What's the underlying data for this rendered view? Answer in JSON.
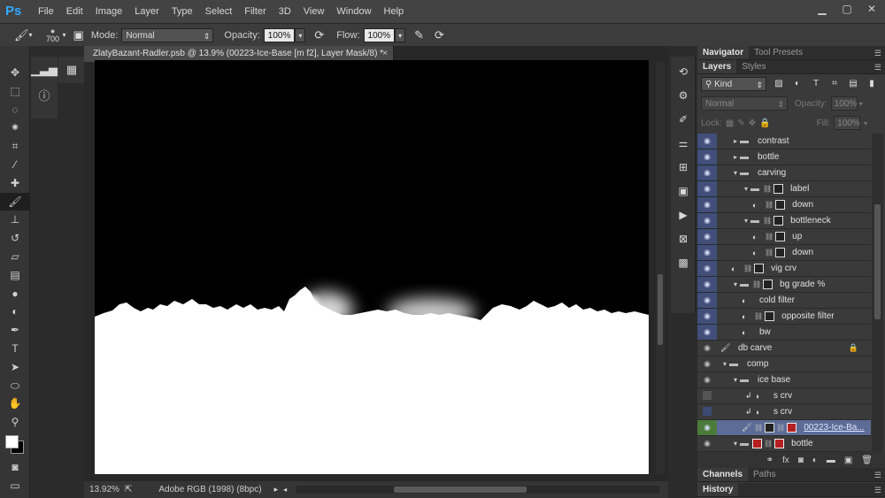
{
  "app": {
    "logo": "Ps"
  },
  "menu": [
    "File",
    "Edit",
    "Image",
    "Layer",
    "Type",
    "Select",
    "Filter",
    "3D",
    "View",
    "Window",
    "Help"
  ],
  "options": {
    "brush_size": "700",
    "mode_label": "Mode:",
    "mode_value": "Normal",
    "opacity_label": "Opacity:",
    "opacity_value": "100%",
    "flow_label": "Flow:",
    "flow_value": "100%"
  },
  "document": {
    "tab_title": "ZlatyBazant-Radler.psb @ 13.9% (00223-Ice-Base [m f2], Layer Mask/8) *",
    "close": "×"
  },
  "status": {
    "zoom": "13.92%",
    "profile": "Adobe RGB (1998) (8bpc)"
  },
  "panels": {
    "top_tabs": [
      "Navigator",
      "Tool Presets"
    ],
    "layer_tabs": [
      "Layers",
      "Styles"
    ],
    "kind": "Kind",
    "blend_mode": "Normal",
    "opacity_label": "Opacity:",
    "opacity_value": "100%",
    "lock_label": "Lock:",
    "fill_label": "Fill:",
    "fill_value": "100%",
    "bottom_tabs1": [
      "Channels",
      "Paths"
    ],
    "bottom_tabs2": [
      "History"
    ]
  },
  "layers": [
    {
      "name": "contrast",
      "indent": 38,
      "type": "group",
      "eye": "blue"
    },
    {
      "name": "bottle",
      "indent": 38,
      "type": "group-closed",
      "eye": "blue"
    },
    {
      "name": "carving",
      "indent": 38,
      "type": "group-open",
      "eye": "blue"
    },
    {
      "name": "label",
      "indent": 50,
      "type": "group-mask",
      "eye": "blue"
    },
    {
      "name": "down",
      "indent": 62,
      "type": "adj-mask",
      "eye": "blue"
    },
    {
      "name": "bottleneck",
      "indent": 50,
      "type": "group-mask",
      "eye": "blue"
    },
    {
      "name": "up",
      "indent": 62,
      "type": "adj-mask",
      "eye": "blue"
    },
    {
      "name": "down",
      "indent": 62,
      "type": "adj-mask",
      "eye": "blue"
    },
    {
      "name": "vig crv",
      "indent": 38,
      "type": "adj-mask",
      "eye": "blue"
    },
    {
      "name": "bg grade %",
      "indent": 38,
      "type": "group-mask",
      "eye": "blue"
    },
    {
      "name": "cold filter",
      "indent": 50,
      "type": "adj",
      "eye": "blue"
    },
    {
      "name": "opposite filter",
      "indent": 50,
      "type": "adj-mask",
      "eye": "blue"
    },
    {
      "name": "bw",
      "indent": 50,
      "type": "adj",
      "eye": "blue"
    },
    {
      "name": "db carve",
      "indent": 26,
      "type": "brush",
      "eye": "grey",
      "locked": true
    },
    {
      "name": "comp",
      "indent": 26,
      "type": "group-open",
      "eye": "grey"
    },
    {
      "name": "ice base",
      "indent": 38,
      "type": "group-open",
      "eye": "grey"
    },
    {
      "name": "s crv",
      "indent": 54,
      "type": "clip-adj",
      "eye": "greybox"
    },
    {
      "name": "s crv",
      "indent": 54,
      "type": "clip-adj",
      "eye": "bluebox"
    },
    {
      "name": "00223-Ice-Ba...",
      "indent": 50,
      "type": "smart-red",
      "eye": "green",
      "selected": true
    },
    {
      "name": "bottle",
      "indent": 38,
      "type": "group-red",
      "eye": "grey"
    }
  ]
}
